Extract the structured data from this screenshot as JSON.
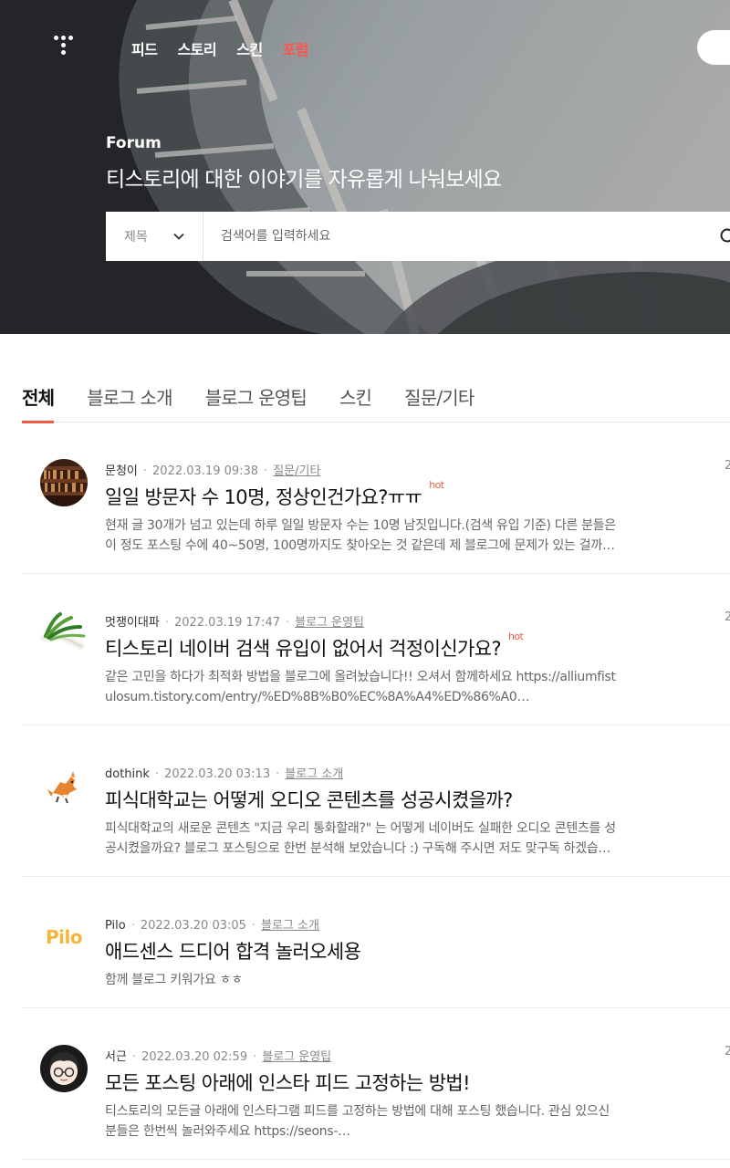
{
  "nav": {
    "items": [
      {
        "label": "피드",
        "active": false
      },
      {
        "label": "스토리",
        "active": false
      },
      {
        "label": "스킨",
        "active": false
      },
      {
        "label": "포럼",
        "active": true
      }
    ]
  },
  "hero": {
    "label": "Forum",
    "title": "티스토리에 대한 이야기를 자유롭게 나눠보세요"
  },
  "search": {
    "scope": "제목",
    "placeholder": "검색어를 입력하세요"
  },
  "tabs": [
    {
      "label": "전체",
      "active": true
    },
    {
      "label": "블로그 소개",
      "active": false
    },
    {
      "label": "블로그 운영팁",
      "active": false
    },
    {
      "label": "스킨",
      "active": false
    },
    {
      "label": "질문/기타",
      "active": false
    }
  ],
  "posts": [
    {
      "author": "문청이",
      "date": "2022.03.19 09:38",
      "category": "질문/기타",
      "title": "일일 방문자 수 10명, 정상인건가요?ㅠㅠ",
      "hot": "hot",
      "summary": "현재 글 30개가 넘고 있는데 하루 일일 방문자 수는 10명 남짓입니다.(검색 유입 기준) 다른 분들은 이 정도 포스팅 수에 40~50명, 100명까지도 찾아오는 것 같은데 제 블로그에 문제가 있는 걸까요…",
      "side": "2"
    },
    {
      "author": "멋쟁이대파",
      "date": "2022.03.19 17:47",
      "category": "블로그 운영팁",
      "title": "티스토리 네이버 검색 유입이 없어서 걱정이신가요?",
      "hot": "hot",
      "summary": "같은 고민을 하다가 최적화 방법을 블로그에 올려놨습니다!! 오셔서 함께하세요 https://alliumfistulosum.tistory.com/entry/%ED%8B%B0%EC%8A%A4%ED%86%A0…",
      "side": "2"
    },
    {
      "author": "dothink",
      "date": "2022.03.20 03:13",
      "category": "블로그 소개",
      "title": "피식대학교는 어떻게 오디오 콘텐츠를 성공시켰을까?",
      "hot": "",
      "summary": "피식대학교의 새로운 콘텐츠 \"지금 우리 통화할래?\" 는 어떻게 네이버도 실패한 오디오 콘텐츠를 성공시켰을까요? 블로그 포스팅으로 한번 분석해 보았습니다 :) 구독해 주시면 저도 맞구독 하겠습…",
      "side": ""
    },
    {
      "author": "Pilo",
      "date": "2022.03.20 03:05",
      "category": "블로그 소개",
      "title": "애드센스 드디어 합격 놀러오세용",
      "hot": "",
      "summary": "함께 블로그 키워가요 ㅎㅎ",
      "side": ""
    },
    {
      "author": "서근",
      "date": "2022.03.20 02:59",
      "category": "블로그 운영팁",
      "title": "모든 포스팅 아래에 인스타 피드 고정하는 방법!",
      "hot": "",
      "summary": "티스토리의 모든글 아래에 인스타그램 피드를 고정하는 방법에 대해 포스팅 했습니다. 관심 있으신 분들은 한번씩 놀러와주세요 https://seons-…",
      "side": "2"
    }
  ],
  "avatars": {
    "pilo_text": "Pilo"
  },
  "colors": {
    "accent": "#ef5b47",
    "nav_active": "#ff5544"
  }
}
